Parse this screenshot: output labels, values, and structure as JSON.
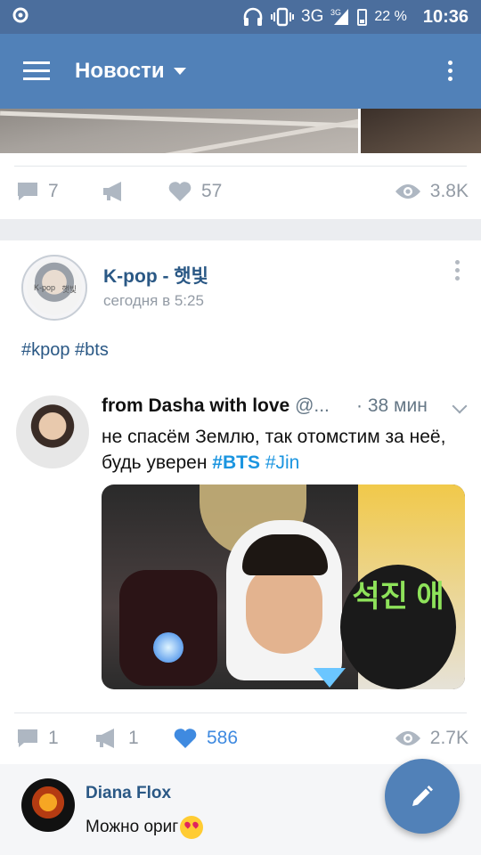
{
  "status_bar": {
    "network": "3G",
    "network_sup": "3G",
    "battery": "22 %",
    "time": "10:36"
  },
  "app_bar": {
    "title": "Новости",
    "menu_icon": "hamburger-icon",
    "more_icon": "more-vert-icon"
  },
  "prev_post": {
    "comments": "7",
    "likes": "57",
    "views": "3.8K"
  },
  "post": {
    "group_name": "K-pop - 햇빛",
    "time": "сегодня в 5:25",
    "avatar_text_left": "K-pop",
    "avatar_text_right": "햇빛",
    "hashtags": "#kpop #bts",
    "tweet": {
      "name": "from Dasha with love",
      "handle": "@...",
      "time": "· 38 мин",
      "text_plain": "не спасём Землю, так отомстим за неё, будь уверен",
      "tag1": "#BTS",
      "tag2": "#Jin",
      "sign_text": "석진 애"
    },
    "comments": "1",
    "reposts": "1",
    "likes": "586",
    "views": "2.7K",
    "accent": "#3f8ae0"
  },
  "comment": {
    "author": "Diana Flox",
    "text": "Можно ориг"
  },
  "colors": {
    "statusbar": "#4b6e9d",
    "appbar": "#5181b8",
    "link": "#2a5885",
    "tweet_link": "#1b95e0"
  }
}
